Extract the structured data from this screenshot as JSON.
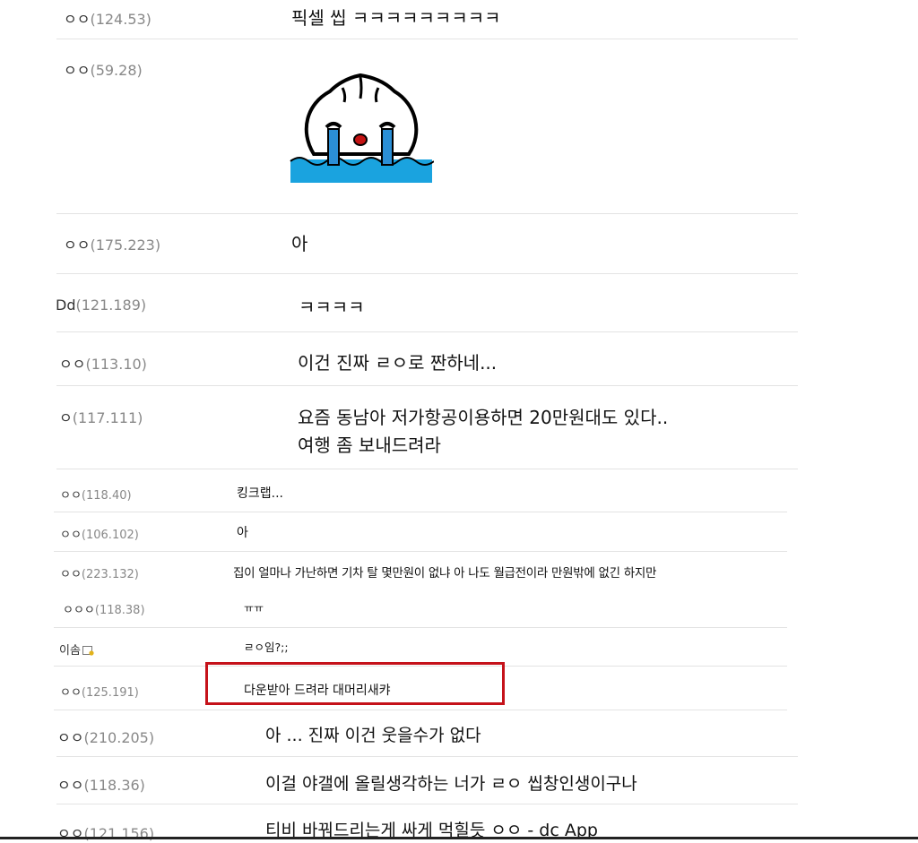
{
  "comments": [
    {
      "nick": "ㅇㅇ",
      "ip": "(124.53)",
      "text": "픽셀 씹 ㅋㅋㅋㅋㅋㅋㅋㅋㅋ"
    },
    {
      "nick": "ㅇㅇ",
      "ip": "(59.28)",
      "text": "",
      "emoticon": "crying-dumpling-emoticon"
    },
    {
      "nick": "ㅇㅇ",
      "ip": "(175.223)",
      "text": "아"
    },
    {
      "nick": "Dd",
      "ip": "(121.189)",
      "text": "ㅋㅋㅋㅋ"
    },
    {
      "nick": "ㅇㅇ",
      "ip": "(113.10)",
      "text": "이건 진짜 ㄹㅇ로 짠하네..."
    },
    {
      "nick": "ㅇ",
      "ip": "(117.111)",
      "text": "요즘 동남아 저가항공이용하면 20만원대도 있다..",
      "text2": "여행 좀 보내드려라"
    }
  ],
  "replies": [
    {
      "nick": "ㅇㅇ",
      "ip": "(118.40)",
      "text": "킹크랩..."
    },
    {
      "nick": "ㅇㅇ",
      "ip": "(106.102)",
      "text": "아"
    },
    {
      "nick": "ㅇㅇ",
      "ip": "(223.132)",
      "text": "집이 얼마나 가난하면 기차 탈 몇만원이 없냐 아 나도 월급전이라 만원밖에 없긴 하지만"
    },
    {
      "nick": "ㅇㅇㅇ",
      "ip": "(118.38)",
      "text": "ㅠㅠ"
    },
    {
      "nick": "이솜",
      "ip": "",
      "text": "ㄹㅇ임?;;"
    },
    {
      "nick": "ㅇㅇ",
      "ip": "(125.191)",
      "text": "다운받아 드려라 대머리새캬"
    }
  ],
  "comments2": [
    {
      "nick": "ㅇㅇ",
      "ip": "(210.205)",
      "text": "아 ... 진짜 이건 웃을수가 없다"
    },
    {
      "nick": "ㅇㅇ",
      "ip": "(118.36)",
      "text": "이걸 야갤에 올릴생각하는 너가 ㄹㅇ 씹창인생이구나"
    },
    {
      "nick": "ㅇㅇ",
      "ip": "(121.156)",
      "text": "티비 바꿔드리는게 싸게 먹힐듯 ㅇㅇ - dc App"
    }
  ],
  "colors": {
    "highlight": "#c5121a",
    "water": "#1aa3df",
    "tears": "#2b8fd6"
  }
}
